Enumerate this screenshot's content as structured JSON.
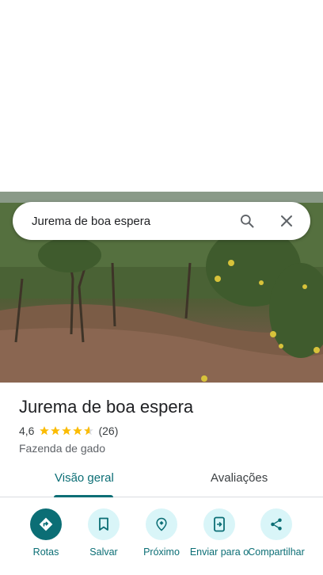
{
  "search": {
    "query": "Jurema de boa espera"
  },
  "place": {
    "name": "Jurema de boa espera",
    "rating": "4,6",
    "rating_value": 4.6,
    "review_count": "(26)",
    "category": "Fazenda de gado"
  },
  "tabs": [
    {
      "label": "Visão geral",
      "active": true
    },
    {
      "label": "Avaliações",
      "active": false
    }
  ],
  "actions": [
    {
      "label": "Rotas",
      "icon": "directions-icon"
    },
    {
      "label": "Salvar",
      "icon": "bookmark-icon"
    },
    {
      "label": "Próximo",
      "icon": "nearby-icon"
    },
    {
      "label": "Enviar para o",
      "icon": "send-to-phone-icon"
    },
    {
      "label": "Compartilhar",
      "icon": "share-icon"
    }
  ],
  "colors": {
    "accent": "#0b6e75",
    "chip_bg": "#d9f5f8",
    "star": "#fbbc04"
  }
}
